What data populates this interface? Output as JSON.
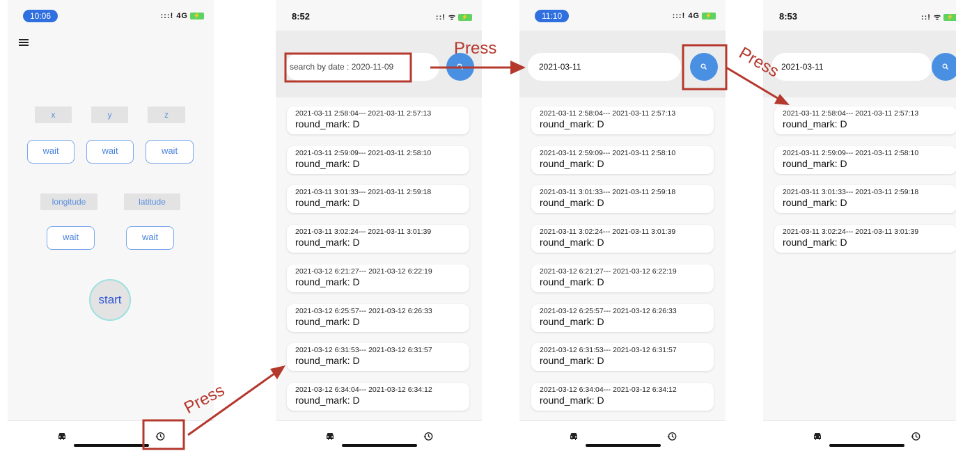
{
  "screens": [
    {
      "time": "10:06",
      "signal": ":::! 4G",
      "sensor_labels": [
        "x",
        "y",
        "z"
      ],
      "sensor_values": [
        "wait",
        "wait",
        "wait"
      ],
      "location_labels": [
        "longitude",
        "latitude"
      ],
      "location_values": [
        "wait",
        "wait"
      ],
      "start_label": "start"
    },
    {
      "time": "8:52",
      "signal": "::! ᯤ",
      "search_placeholder": "search by date : 2020-11-09",
      "search_value": ""
    },
    {
      "time": "11:10",
      "signal": ":::! 4G",
      "search_value": "2021-03-11"
    },
    {
      "time": "8:53",
      "signal": "::! ᯤ",
      "search_value": "2021-03-11"
    }
  ],
  "records_all": [
    {
      "time": "2021-03-11 2:58:04--- 2021-03-11 2:57:13",
      "mark": "round_mark: D"
    },
    {
      "time": "2021-03-11 2:59:09--- 2021-03-11 2:58:10",
      "mark": "round_mark: D"
    },
    {
      "time": "2021-03-11 3:01:33--- 2021-03-11 2:59:18",
      "mark": "round_mark: D"
    },
    {
      "time": "2021-03-11 3:02:24--- 2021-03-11 3:01:39",
      "mark": "round_mark: D"
    },
    {
      "time": "2021-03-12 6:21:27--- 2021-03-12 6:22:19",
      "mark": "round_mark: D"
    },
    {
      "time": "2021-03-12 6:25:57--- 2021-03-12 6:26:33",
      "mark": "round_mark: D"
    },
    {
      "time": "2021-03-12 6:31:53--- 2021-03-12 6:31:57",
      "mark": "round_mark: D"
    },
    {
      "time": "2021-03-12 6:34:04--- 2021-03-12 6:34:12",
      "mark": "round_mark: D"
    }
  ],
  "records_filtered": [
    {
      "time": "2021-03-11 2:58:04--- 2021-03-11 2:57:13",
      "mark": "round_mark: D"
    },
    {
      "time": "2021-03-11 2:59:09--- 2021-03-11 2:58:10",
      "mark": "round_mark: D"
    },
    {
      "time": "2021-03-11 3:01:33--- 2021-03-11 2:59:18",
      "mark": "round_mark: D"
    },
    {
      "time": "2021-03-11 3:02:24--- 2021-03-11 3:01:39",
      "mark": "round_mark: D"
    }
  ],
  "annotations": {
    "press_label": "Press",
    "color": "#b5382d"
  },
  "icons": {
    "menu": "menu-icon",
    "search": "search-icon",
    "nav_left": "car-icon",
    "nav_right": "history-icon"
  },
  "colors": {
    "accent_blue": "#4a90e2",
    "chip_bg": "#e3e3e3",
    "annotation_red": "#b5382d"
  }
}
